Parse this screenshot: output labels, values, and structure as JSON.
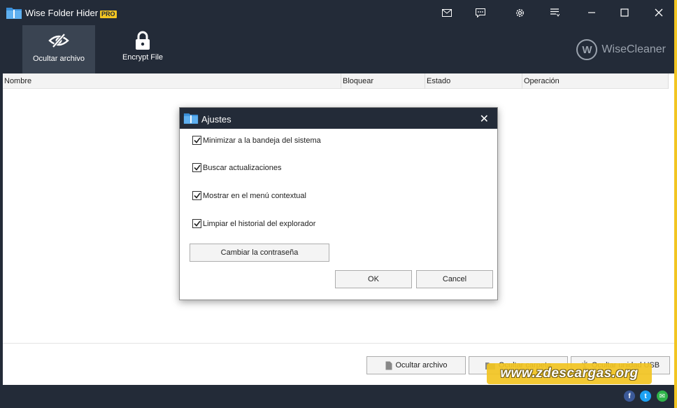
{
  "window": {
    "title": "Wise Folder Hider",
    "badge": "PRO",
    "brand": "WiseCleaner",
    "brand_logo_letter": "W"
  },
  "titlebar_icons": [
    "mail-icon",
    "feedback-icon",
    "gear-icon",
    "menu-icon",
    "minimize-icon",
    "maximize-icon",
    "close-icon"
  ],
  "toolbar": {
    "tabs": [
      {
        "label": "Ocultar archivo",
        "icon": "eye-slash-icon",
        "active": true
      },
      {
        "label": "Encrypt File",
        "icon": "lock-icon",
        "active": false
      }
    ]
  },
  "table": {
    "columns": [
      "Nombre",
      "Bloquear",
      "Estado",
      "Operación"
    ]
  },
  "bottom_buttons": [
    {
      "label": "Ocultar archivo",
      "icon": "file-icon"
    },
    {
      "label": "Ocultar carpeta",
      "icon": "folder-icon"
    },
    {
      "label": "Ocultar unidad USB",
      "icon": "usb-icon"
    }
  ],
  "watermark": "www.zdescargas.org",
  "social": [
    {
      "name": "facebook-icon",
      "glyph": "f",
      "color": "#3b5998"
    },
    {
      "name": "twitter-icon",
      "glyph": "t",
      "color": "#1da1f2"
    },
    {
      "name": "email-share-icon",
      "glyph": "✉",
      "color": "#2fb34a"
    }
  ],
  "dialog": {
    "title": "Ajustes",
    "options": [
      {
        "label": "Minimizar a la bandeja del sistema",
        "checked": true
      },
      {
        "label": "Buscar actualizaciones",
        "checked": true
      },
      {
        "label": "Mostrar en el menú contextual",
        "checked": true
      },
      {
        "label": "Limpiar el historial del explorador",
        "checked": true
      }
    ],
    "change_password_label": "Cambiar la contraseña",
    "ok_label": "OK",
    "cancel_label": "Cancel"
  },
  "colors": {
    "chrome": "#232b38",
    "accent": "#f2c522"
  }
}
